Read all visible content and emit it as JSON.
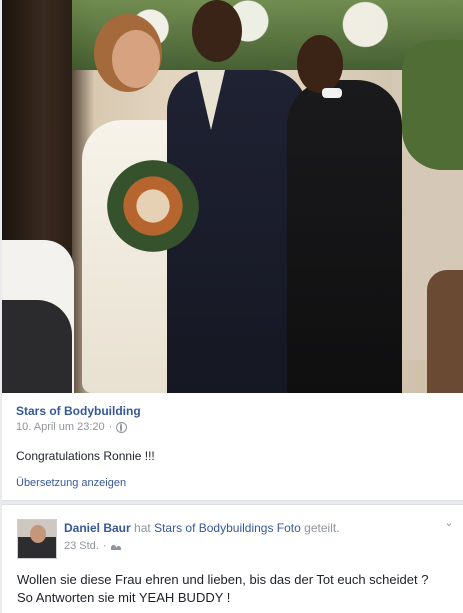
{
  "photo": {
    "alt": ""
  },
  "post": {
    "page_name": "Stars of Bodybuilding",
    "date": "10. April um 23:20",
    "separator": "·",
    "text": "Congratulations Ronnie !!!",
    "translate_label": "Übersetzung anzeigen"
  },
  "share": {
    "actor_name": "Daniel Baur",
    "verb": "hat",
    "shared_page": "Stars of Bodybuilding",
    "suffix": "s Foto",
    "action": "geteilt.",
    "time": "23 Std.",
    "separator": "·",
    "text_line1": "Wollen sie diese Frau ehren und lieben, bis das der Tot euch scheidet ?",
    "text_line2": "So Antworten sie mit YEAH BUDDY !"
  },
  "icons": {
    "privacy_public": "globe-icon",
    "privacy_friends": "friends-icon",
    "options": "chevron-down-icon"
  },
  "colors": {
    "link": "#365899",
    "meta": "#90949c",
    "text": "#1d2129",
    "background": "#e9ebee"
  }
}
